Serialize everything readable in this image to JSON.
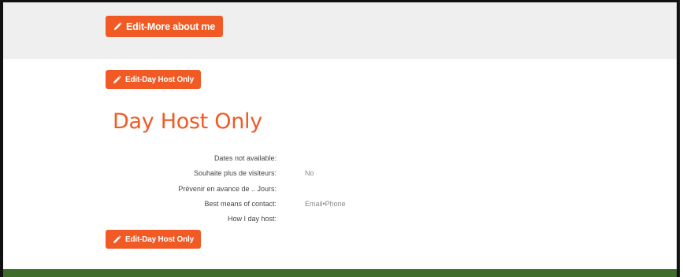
{
  "buttons": {
    "edit_more_about_me": "Edit-More about me",
    "edit_day_host_top": "Edit-Day Host Only",
    "edit_day_host_bottom": "Edit-Day Host Only"
  },
  "section": {
    "title": "Day Host Only"
  },
  "fields": [
    {
      "label": "Dates not available:",
      "value": ""
    },
    {
      "label": "Souhaite plus de visiteurs:",
      "value": "No"
    },
    {
      "label": "Prévenir en avance de .. Jours:",
      "value": ""
    },
    {
      "label": "Best means of contact:",
      "value": "Email•Phone"
    },
    {
      "label": "How I day host:",
      "value": ""
    }
  ],
  "icons": {
    "edit": "pencil-icon"
  },
  "colors": {
    "accent": "#f15a24",
    "top_band": "#efefef",
    "footer": "#3f6e2c"
  }
}
